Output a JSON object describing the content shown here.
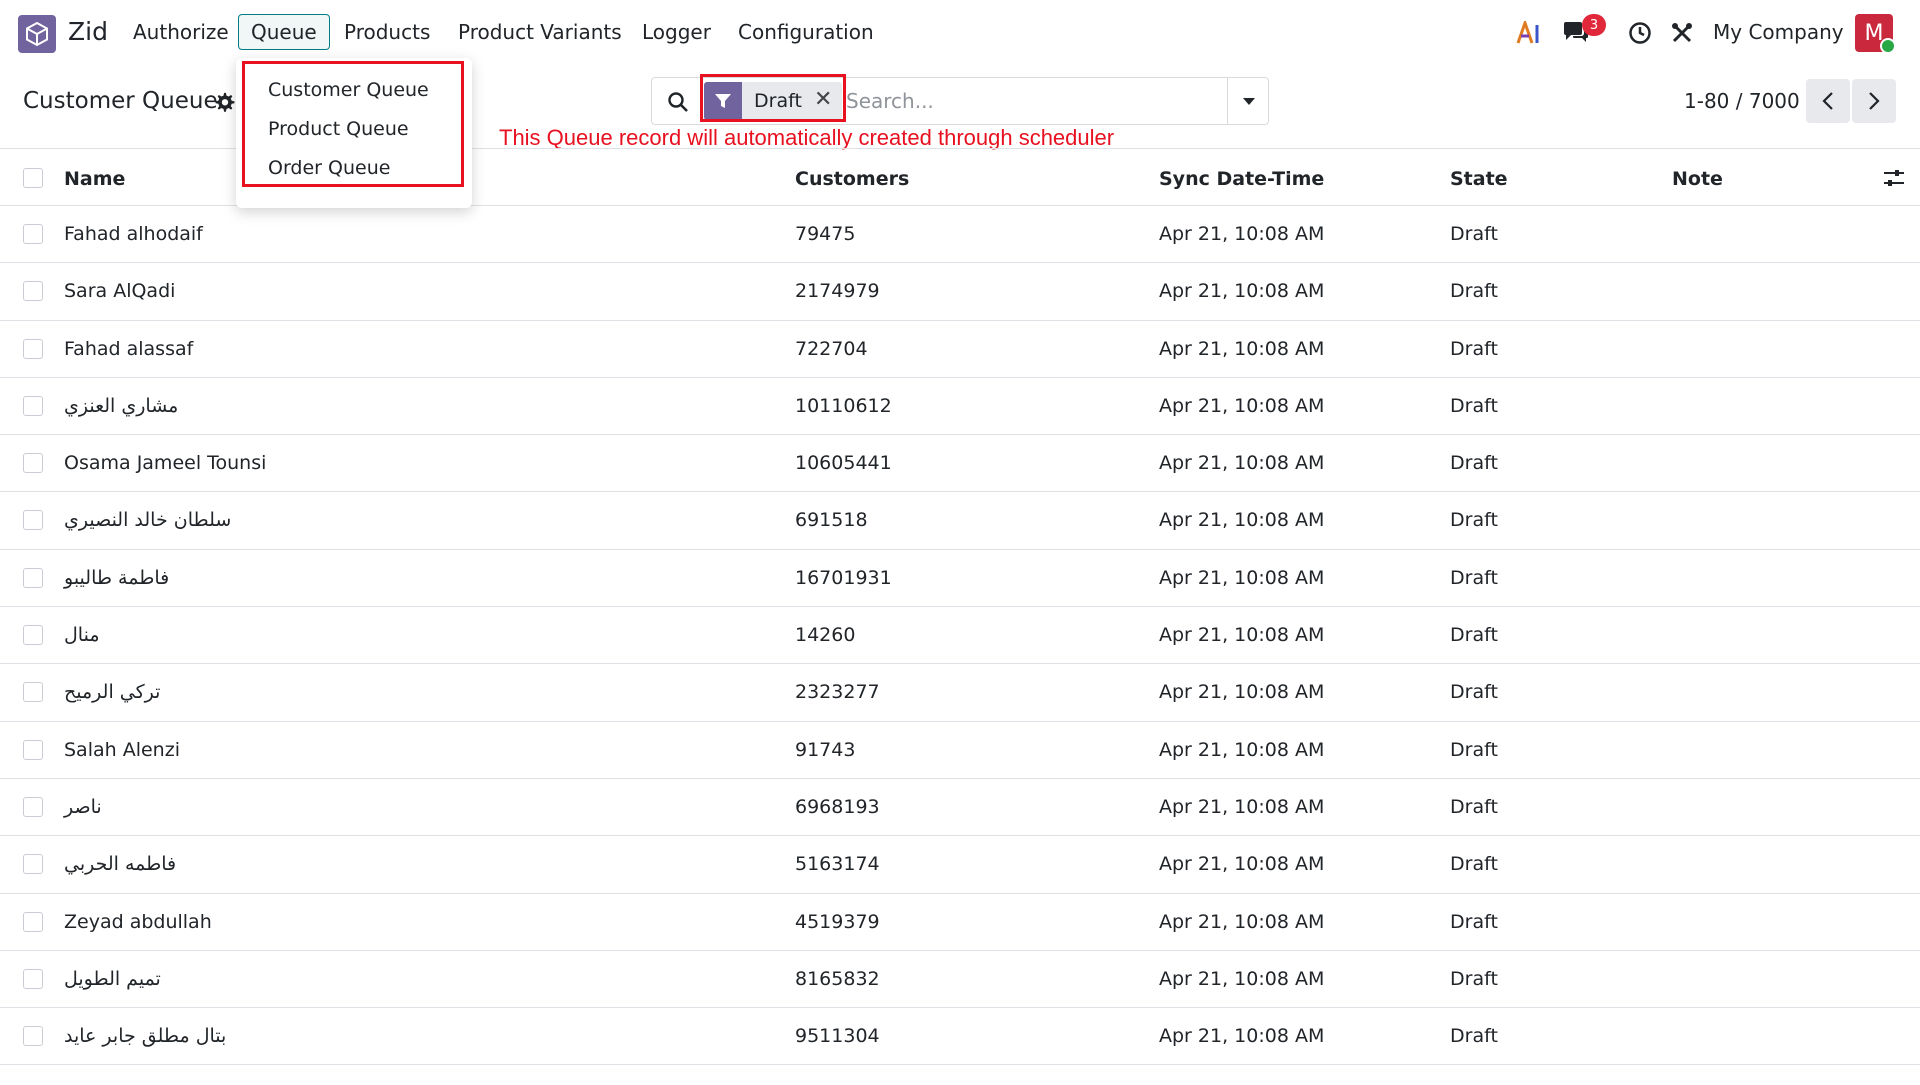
{
  "nav": {
    "app_name": "Zid",
    "menu": [
      "Authorize",
      "Queue",
      "Products",
      "Product Variants",
      "Logger",
      "Configuration"
    ],
    "active_menu": "Queue",
    "company": "My Company",
    "avatar_letter": "M",
    "message_count": "3"
  },
  "dropdown": {
    "items": [
      "Customer Queue",
      "Product Queue",
      "Order Queue"
    ]
  },
  "control_panel": {
    "title": "Customer Queue",
    "facet_value": "Draft",
    "search_placeholder": "Search...",
    "pager": "1-80 / 7000"
  },
  "annotation": "This Queue  record will automatically created through scheduler",
  "table": {
    "columns": [
      "Name",
      "Customers",
      "Sync Date-Time",
      "State",
      "Note"
    ],
    "rows": [
      {
        "name": "Fahad alhodaif",
        "customers": "79475",
        "sync": "Apr 21, 10:08 AM",
        "state": "Draft"
      },
      {
        "name": "Sara AlQadi",
        "customers": "2174979",
        "sync": "Apr 21, 10:08 AM",
        "state": "Draft"
      },
      {
        "name": "Fahad alassaf",
        "customers": "722704",
        "sync": "Apr 21, 10:08 AM",
        "state": "Draft"
      },
      {
        "name": "مشاري العنزي",
        "customers": "10110612",
        "sync": "Apr 21, 10:08 AM",
        "state": "Draft"
      },
      {
        "name": "Osama Jameel Tounsi",
        "customers": "10605441",
        "sync": "Apr 21, 10:08 AM",
        "state": "Draft"
      },
      {
        "name": "سلطان خالد النصيري",
        "customers": "691518",
        "sync": "Apr 21, 10:08 AM",
        "state": "Draft"
      },
      {
        "name": "فاطمة طاليبو",
        "customers": "16701931",
        "sync": "Apr 21, 10:08 AM",
        "state": "Draft"
      },
      {
        "name": "منال",
        "customers": "14260",
        "sync": "Apr 21, 10:08 AM",
        "state": "Draft"
      },
      {
        "name": "تركي الرميح",
        "customers": "2323277",
        "sync": "Apr 21, 10:08 AM",
        "state": "Draft"
      },
      {
        "name": "Salah Alenzi",
        "customers": "91743",
        "sync": "Apr 21, 10:08 AM",
        "state": "Draft"
      },
      {
        "name": "ناصر",
        "customers": "6968193",
        "sync": "Apr 21, 10:08 AM",
        "state": "Draft"
      },
      {
        "name": "فاطمه الحربي",
        "customers": "5163174",
        "sync": "Apr 21, 10:08 AM",
        "state": "Draft"
      },
      {
        "name": "Zeyad abdullah",
        "customers": "4519379",
        "sync": "Apr 21, 10:08 AM",
        "state": "Draft"
      },
      {
        "name": "تميم الطويل",
        "customers": "8165832",
        "sync": "Apr 21, 10:08 AM",
        "state": "Draft"
      },
      {
        "name": "بتال مطلق جابر عايد",
        "customers": "9511304",
        "sync": "Apr 21, 10:08 AM",
        "state": "Draft"
      }
    ]
  },
  "colors": {
    "brand": "#71639e",
    "highlight": "#e8111f",
    "active_nav_border": "#017e84",
    "badge": "#e0283a",
    "avatar": "#c9283d"
  }
}
